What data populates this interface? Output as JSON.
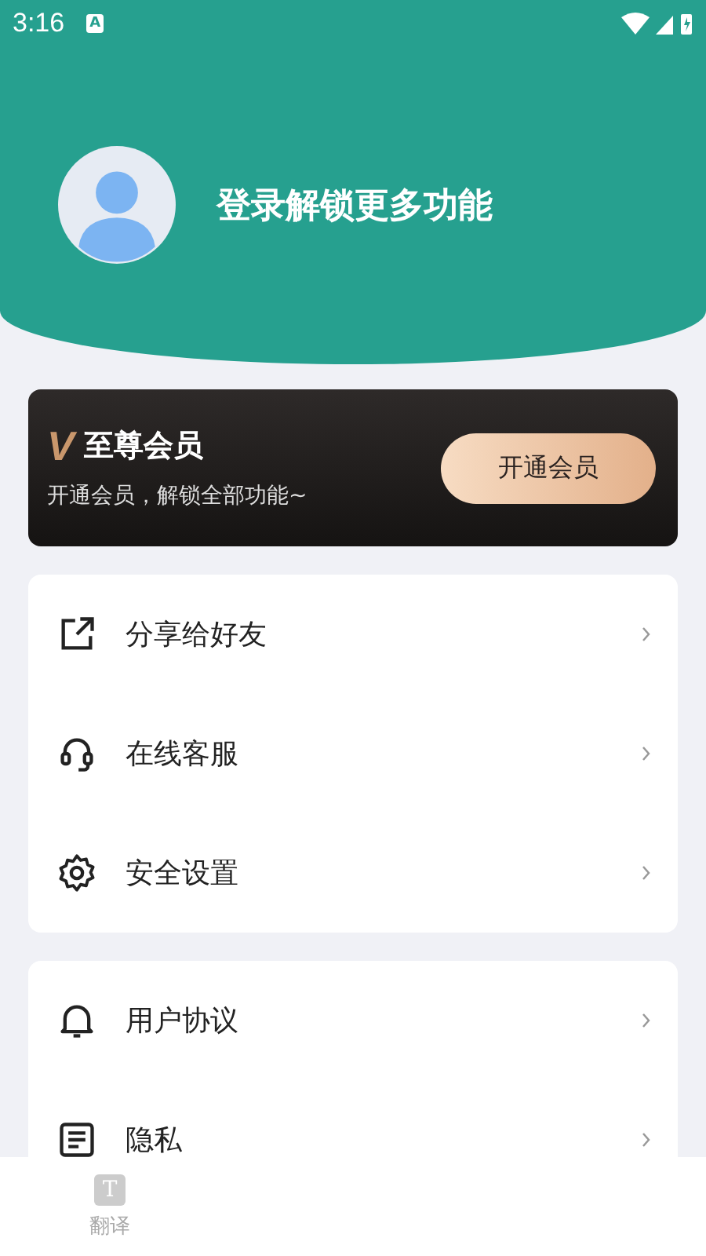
{
  "status_bar": {
    "time": "3:16",
    "badge": "A"
  },
  "profile": {
    "title": "登录解锁更多功能"
  },
  "vip": {
    "mark": "V",
    "title": "至尊会员",
    "subtitle": "开通会员，解锁全部功能~",
    "button": "开通会员"
  },
  "menu_groups": [
    {
      "items": [
        {
          "label": "分享给好友"
        },
        {
          "label": "在线客服"
        },
        {
          "label": "安全设置"
        }
      ]
    },
    {
      "items": [
        {
          "label": "用户协议"
        },
        {
          "label": "隐私"
        }
      ]
    }
  ],
  "bottom_nav": [
    {
      "icon_letter": "T",
      "label": "翻译",
      "selected": false
    }
  ]
}
